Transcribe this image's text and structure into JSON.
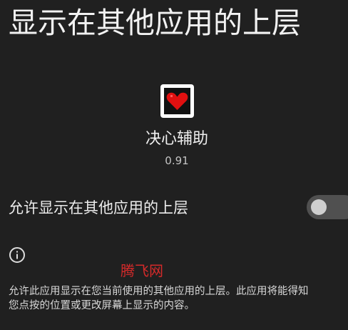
{
  "page": {
    "title": "显示在其他应用的上层"
  },
  "app": {
    "name": "决心辅助",
    "version": "0.91",
    "icon": "heart-app-icon"
  },
  "setting": {
    "label": "允许显示在其他应用的上层",
    "toggle_state": "off"
  },
  "info": {
    "icon": "info-icon",
    "watermark": "腾飞网",
    "description_line1": "允许此应用显示在您当前使用的其他应用的上层。此应用将能得知",
    "description_line2": "您点按的位置或更改屏幕上显示的内容。"
  },
  "colors": {
    "background": "#202020",
    "toggle_track": "#505050",
    "toggle_thumb": "#cfcfcf",
    "heart_red": "#e01010",
    "watermark_red": "#d42a2a"
  }
}
